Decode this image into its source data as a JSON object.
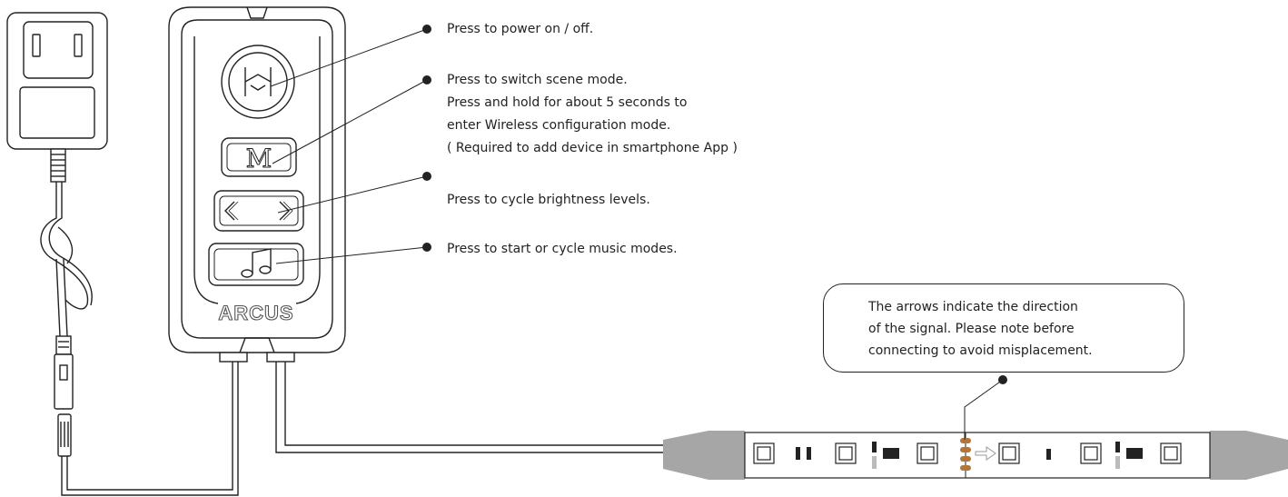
{
  "controller": {
    "brand": "ARCUS",
    "mode_button_letter": "M",
    "prev_arrow": "<",
    "next_arrow": ">",
    "music_glyph": "♫"
  },
  "callouts": {
    "power": "Press to power on / off.",
    "scene": [
      "Press to switch scene mode.",
      "Press and hold for about 5 seconds to",
      "enter Wireless configuration mode.",
      "( Required to add device in smartphone App )"
    ],
    "brightness": "Press to cycle brightness levels.",
    "music": "Press to start or cycle music modes."
  },
  "note": [
    "The arrows indicate the direction",
    "of the signal. Please note before",
    "connecting to avoid misplacement."
  ],
  "colors": {
    "line": "#222222",
    "connector_gray": "#a6a6a6",
    "resistor_copper": "#b0763a"
  }
}
